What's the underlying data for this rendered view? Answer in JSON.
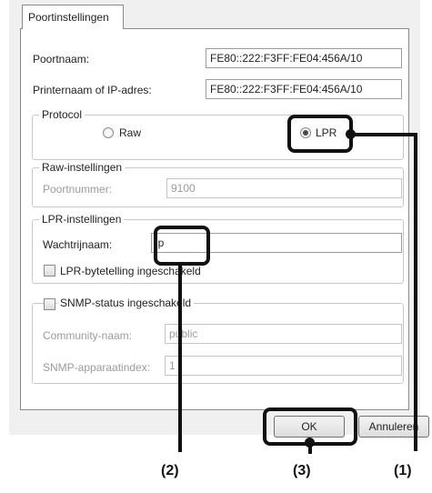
{
  "tab": {
    "label": "Poortinstellingen"
  },
  "port_name": {
    "label": "Poortnaam:",
    "value": "FE80::222:F3FF:FE04:456A/10"
  },
  "printer_name": {
    "label": "Printernaam of IP-adres:",
    "value": "FE80::222:F3FF:FE04:456A/10"
  },
  "protocol": {
    "legend": "Protocol",
    "raw": "Raw",
    "lpr": "LPR",
    "selected": "LPR"
  },
  "raw_settings": {
    "legend": "Raw-instellingen",
    "port_label": "Poortnummer:",
    "port_value": "9100"
  },
  "lpr_settings": {
    "legend": "LPR-instellingen",
    "queue_label": "Wachtrijnaam:",
    "queue_value": "lp",
    "byte_count_label": "LPR-bytetelling ingeschakeld"
  },
  "snmp": {
    "legend": "SNMP-status ingeschakeld",
    "community_label": "Community-naam:",
    "community_value": "public",
    "index_label": "SNMP-apparaatindex:",
    "index_value": "1"
  },
  "buttons": {
    "ok": "OK",
    "cancel": "Annuleren"
  },
  "callouts": [
    "(1)",
    "(2)",
    "(3)"
  ]
}
